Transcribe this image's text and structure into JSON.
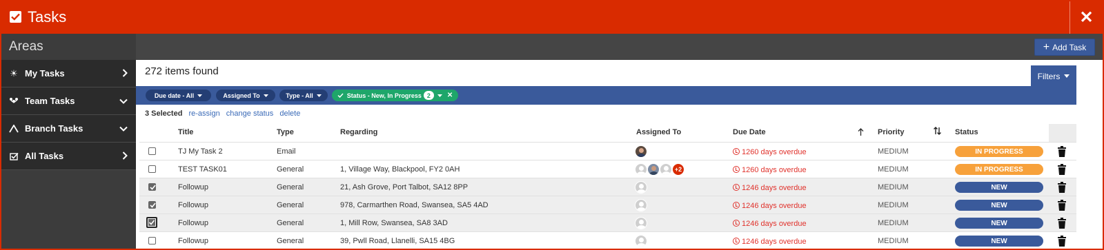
{
  "window": {
    "title": "Tasks",
    "close_label": "✕"
  },
  "sidebar": {
    "heading": "Areas",
    "items": [
      {
        "label": "My Tasks",
        "icon": "sun-icon",
        "chevron": "right"
      },
      {
        "label": "Team Tasks",
        "icon": "team-icon",
        "chevron": "down"
      },
      {
        "label": "Branch Tasks",
        "icon": "branch-icon",
        "chevron": "down"
      },
      {
        "label": "All Tasks",
        "icon": "tasks-icon",
        "chevron": "right"
      }
    ]
  },
  "toolbar": {
    "add_task_label": "Add Task"
  },
  "results": {
    "count_text": "272 items found",
    "filters_label": "Filters"
  },
  "filter_chips": [
    {
      "label": "Due date - All"
    },
    {
      "label": "Assigned To"
    },
    {
      "label": "Type - All"
    },
    {
      "label": "Status - New, In Progress",
      "count": "2",
      "active": true
    }
  ],
  "selection": {
    "count_text": "3 Selected",
    "reassign": "re-assign",
    "change_status": "change status",
    "delete": "delete"
  },
  "table": {
    "columns": {
      "title": "Title",
      "type": "Type",
      "regarding": "Regarding",
      "assigned_to": "Assigned To",
      "due_date": "Due Date",
      "priority": "Priority",
      "status": "Status"
    },
    "rows": [
      {
        "checked": false,
        "title": "TJ My Task 2",
        "type": "Email",
        "regarding": "",
        "due": "1260 days overdue",
        "priority": "MEDIUM",
        "status": "IN PROGRESS"
      },
      {
        "checked": false,
        "title": "TEST TASK01",
        "type": "General",
        "regarding": "1, Village Way, Blackpool, FY2 0AH",
        "due": "1260 days overdue",
        "priority": "MEDIUM",
        "status": "IN PROGRESS",
        "extra_assignees": "+2"
      },
      {
        "checked": true,
        "title": "Followup",
        "type": "General",
        "regarding": "21, Ash Grove, Port Talbot, SA12 8PP",
        "due": "1246 days overdue",
        "priority": "MEDIUM",
        "status": "NEW"
      },
      {
        "checked": true,
        "title": "Followup",
        "type": "General",
        "regarding": "978, Carmarthen Road, Swansea, SA5 4AD",
        "due": "1246 days overdue",
        "priority": "MEDIUM",
        "status": "NEW"
      },
      {
        "checked": true,
        "title": "Followup",
        "type": "General",
        "regarding": "1, Mill Row, Swansea, SA8 3AD",
        "due": "1246 days overdue",
        "priority": "MEDIUM",
        "status": "NEW"
      },
      {
        "checked": false,
        "title": "Followup",
        "type": "General",
        "regarding": "39, Pwll Road, Llanelli, SA15 4BG",
        "due": "1246 days overdue",
        "priority": "MEDIUM",
        "status": "NEW"
      }
    ]
  },
  "colors": {
    "brand_red": "#d92b00",
    "primary_blue": "#3a5a9b",
    "status_in_progress": "#f7a13b",
    "status_new": "#3a5a9b",
    "overdue_red": "#e0312b",
    "chip_active_green": "#1ea66a"
  }
}
